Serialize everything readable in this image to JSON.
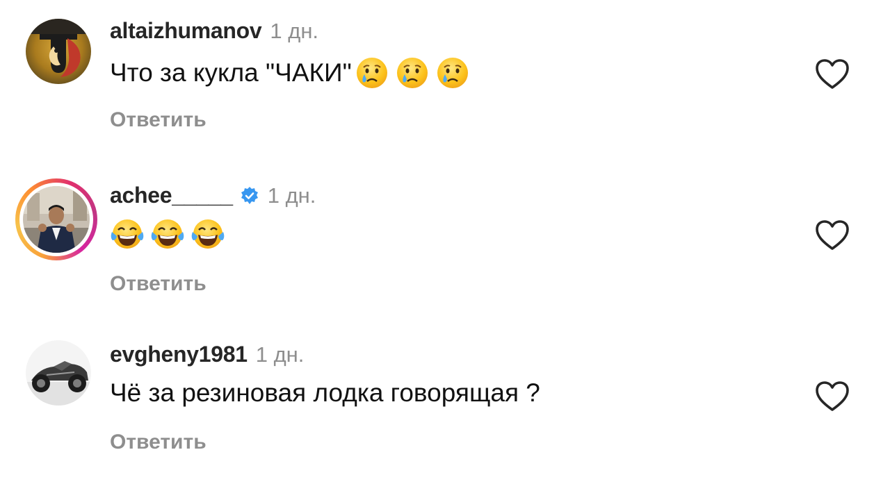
{
  "comments": [
    {
      "username": "altaizhumanov",
      "time": "1 дн.",
      "text": "Что за кукла \"ЧАКИ\"",
      "emojis": [
        "crying-face",
        "crying-face",
        "crying-face"
      ],
      "reply_label": "Ответить",
      "verified": false
    },
    {
      "username": "achee_____",
      "time": "1 дн.",
      "text": "",
      "emojis": [
        "face-with-tears-of-joy",
        "face-with-tears-of-joy",
        "face-with-tears-of-joy"
      ],
      "reply_label": "Ответить",
      "verified": true
    },
    {
      "username": "evgheny1981",
      "time": "1 дн.",
      "text": "Чё за резиновая лодка говорящая ?",
      "emojis": [],
      "reply_label": "Ответить",
      "verified": false
    }
  ],
  "colors": {
    "username": "#262626",
    "meta": "#8e8e8e",
    "verified_badge": "#3897f0",
    "heart_outline": "#262626"
  },
  "icons": {
    "like": "heart-outline-icon",
    "verified": "verified-badge-icon"
  }
}
